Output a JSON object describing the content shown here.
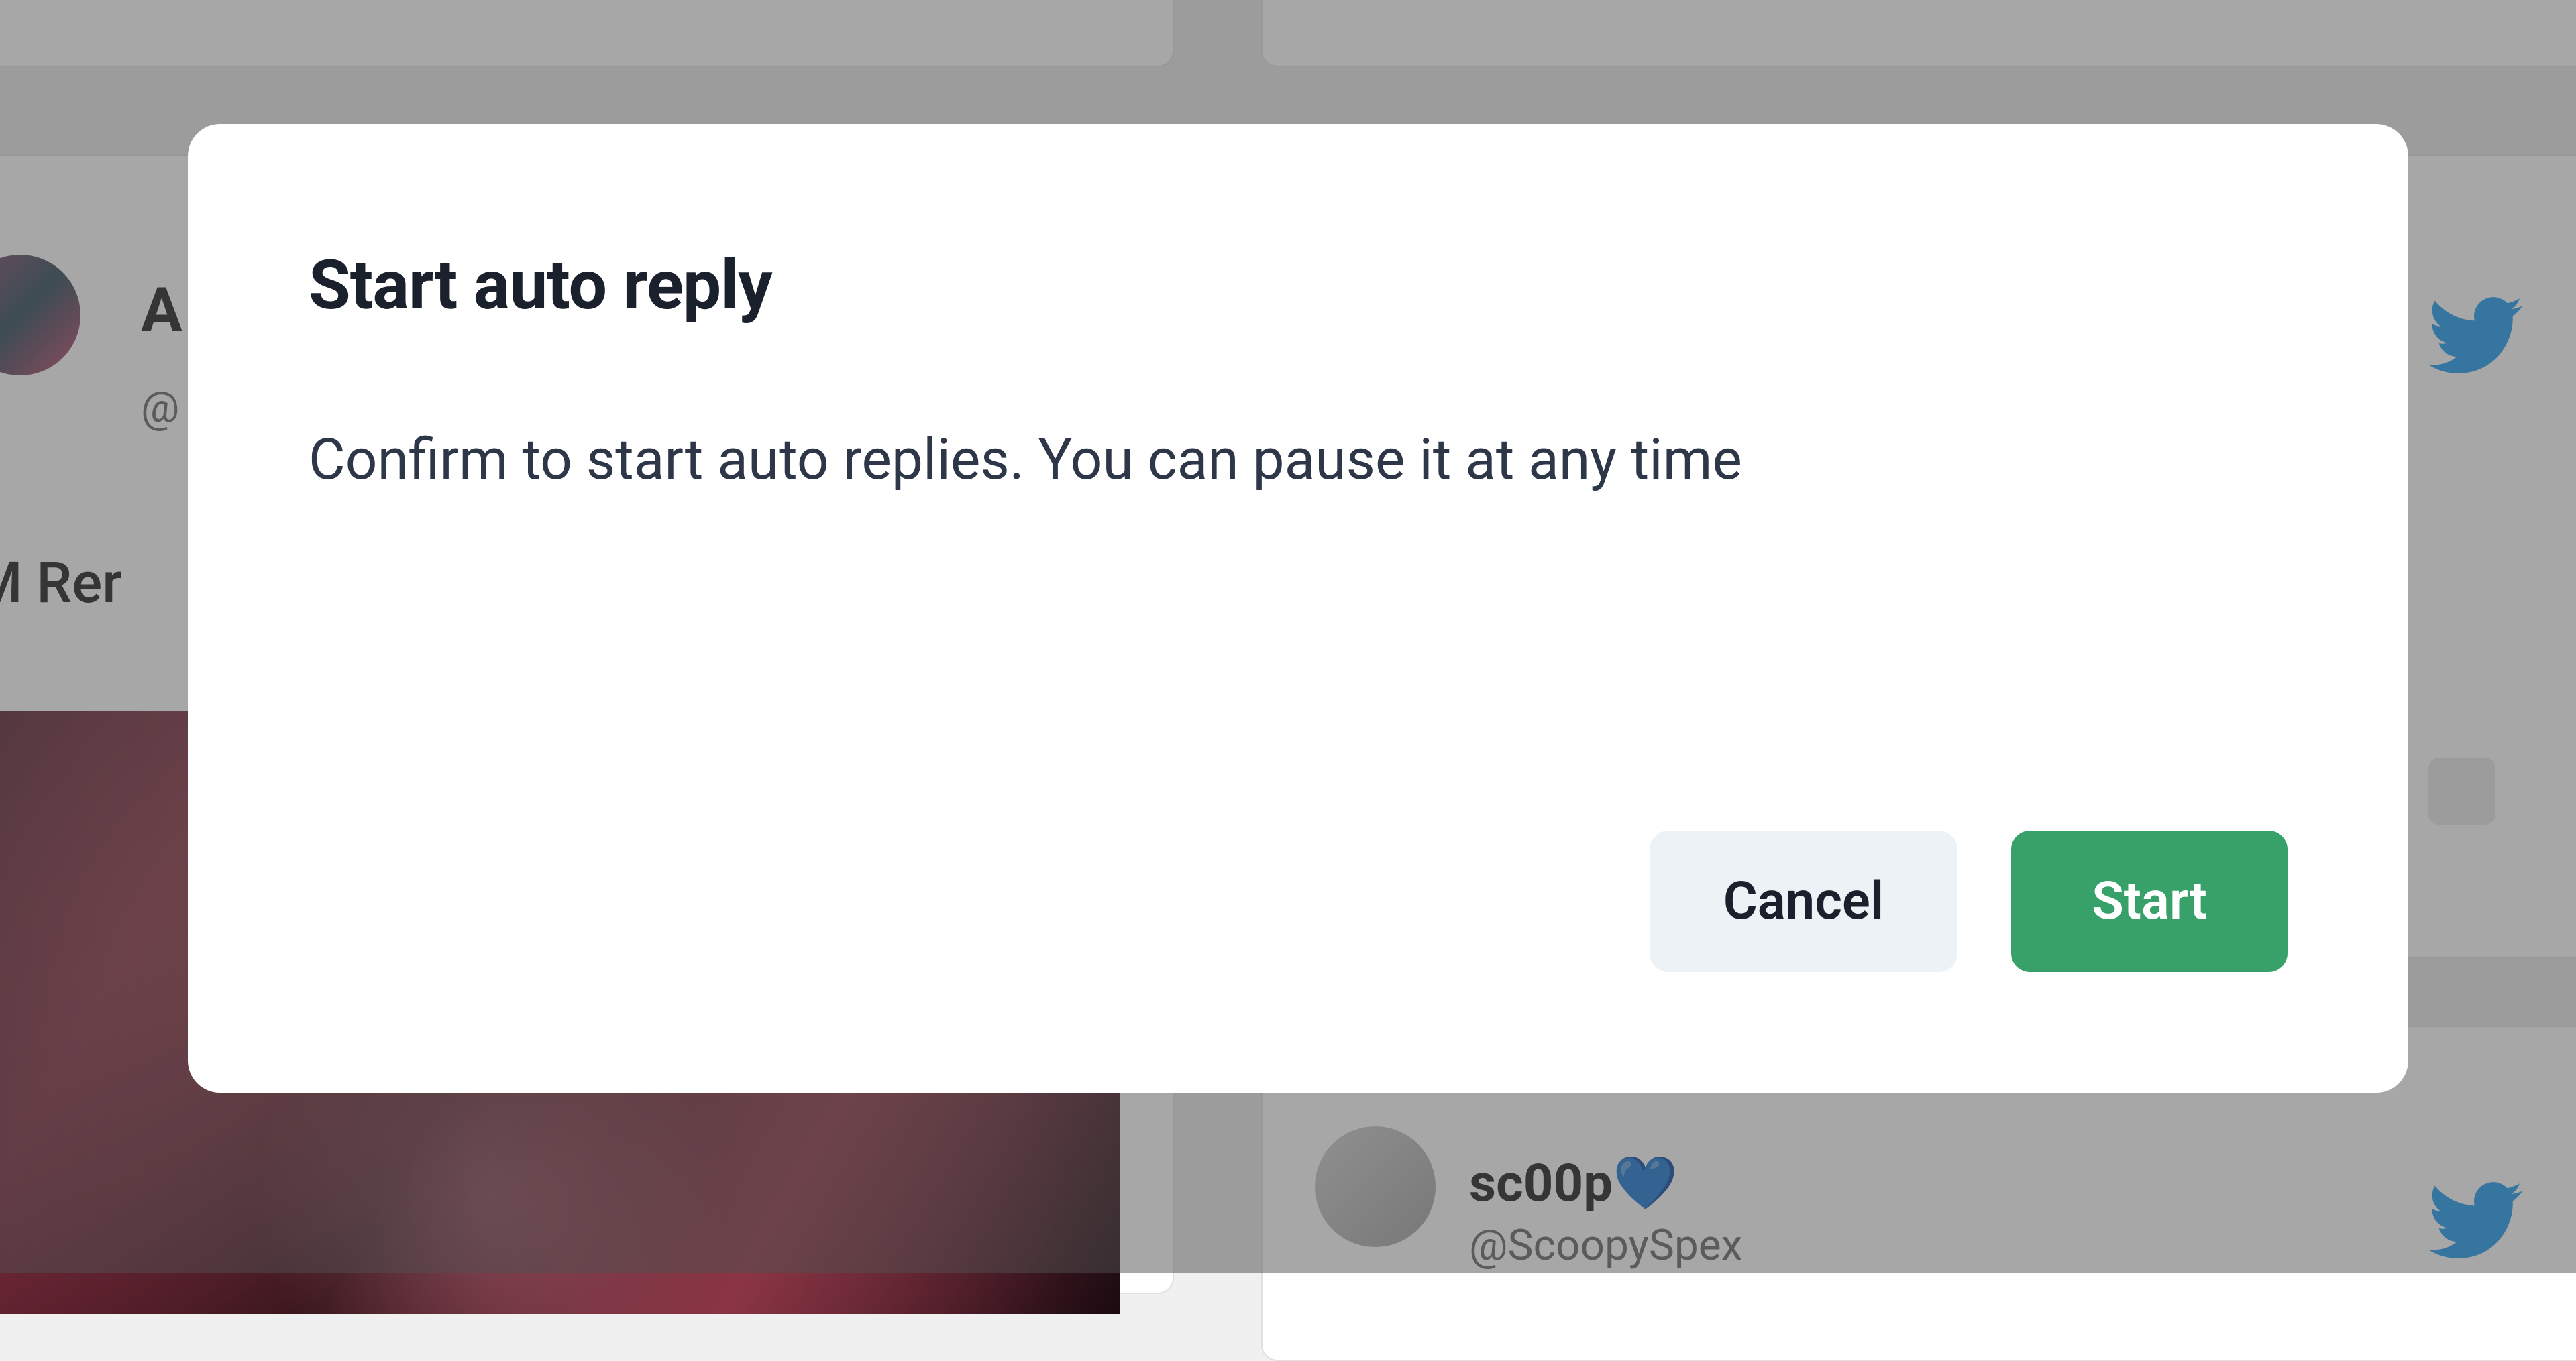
{
  "modal": {
    "title": "Start auto reply",
    "body": "Confirm to start auto replies. You can pause it at any time",
    "cancel_label": "Cancel",
    "start_label": "Start"
  },
  "background": {
    "user1_initial": "A",
    "user1_at": "@",
    "post_text": "M Rer",
    "user2_name": "sc00p",
    "user2_heart": "💙",
    "user2_handle": "@ScoopySpex"
  },
  "colors": {
    "primary_green": "#38a169",
    "twitter_blue": "#1d9bf0",
    "text_dark": "#1a202c",
    "text_body": "#2d3748",
    "btn_light": "#edf2f7"
  }
}
